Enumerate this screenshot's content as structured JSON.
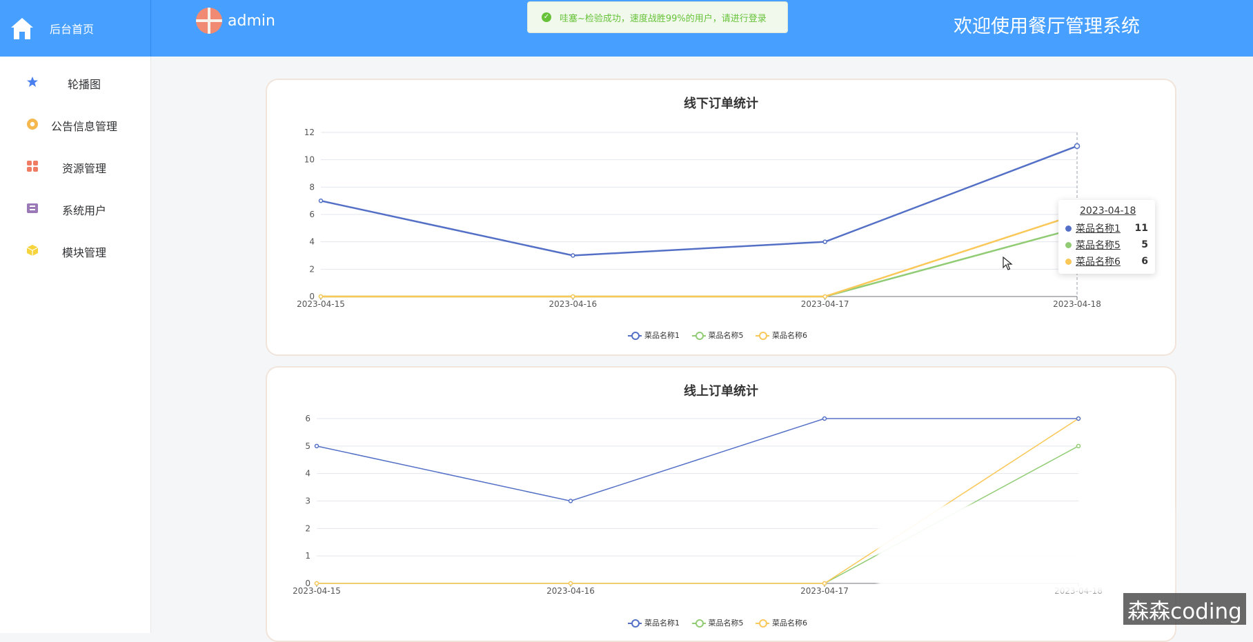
{
  "header": {
    "home_label": "后台首页",
    "username": "admin",
    "welcome": "欢迎使用餐厅管理系统",
    "toast": "哇塞~检验成功，速度战胜99%的用户，请进行登录"
  },
  "sidebar": {
    "items": [
      {
        "label": "轮播图",
        "icon": "star-icon",
        "color": "#4a7fef"
      },
      {
        "label": "公告信息管理",
        "icon": "badge-icon",
        "color": "#f5b84f"
      },
      {
        "label": "资源管理",
        "icon": "grid-icon",
        "color": "#f07c63"
      },
      {
        "label": "系统用户",
        "icon": "archive-icon",
        "color": "#9b78b6"
      },
      {
        "label": "模块管理",
        "icon": "cube-icon",
        "color": "#f7d43b"
      }
    ]
  },
  "tooltip": {
    "date": "2023-04-18",
    "rows": [
      {
        "name": "菜品名称1",
        "value": "11",
        "color": "#5470c6"
      },
      {
        "name": "菜品名称5",
        "value": "5",
        "color": "#91cc75"
      },
      {
        "name": "菜品名称6",
        "value": "6",
        "color": "#fac858"
      }
    ]
  },
  "watermark": "森森coding",
  "chart_data": [
    {
      "type": "line",
      "title": "线下订单统计",
      "x": [
        "2023-04-15",
        "2023-04-16",
        "2023-04-17",
        "2023-04-18"
      ],
      "ylim": [
        0,
        12
      ],
      "yticks": [
        0,
        2,
        4,
        6,
        8,
        10,
        12
      ],
      "series": [
        {
          "name": "菜品名称1",
          "values": [
            7,
            3,
            4,
            11
          ],
          "color": "#5470c6"
        },
        {
          "name": "菜品名称5",
          "values": [
            0,
            0,
            0,
            5
          ],
          "color": "#91cc75"
        },
        {
          "name": "菜品名称6",
          "values": [
            0,
            0,
            0,
            6
          ],
          "color": "#fac858"
        }
      ]
    },
    {
      "type": "line",
      "title": "线上订单统计",
      "x": [
        "2023-04-15",
        "2023-04-16",
        "2023-04-17",
        "2023-04-18"
      ],
      "ylim": [
        0,
        6
      ],
      "yticks": [
        0,
        1,
        2,
        3,
        4,
        5,
        6
      ],
      "series": [
        {
          "name": "菜品名称1",
          "values": [
            5,
            3,
            6,
            6
          ],
          "color": "#5470c6"
        },
        {
          "name": "菜品名称5",
          "values": [
            0,
            0,
            0,
            5
          ],
          "color": "#91cc75"
        },
        {
          "name": "菜品名称6",
          "values": [
            0,
            0,
            0,
            6
          ],
          "color": "#fac858"
        }
      ]
    }
  ]
}
